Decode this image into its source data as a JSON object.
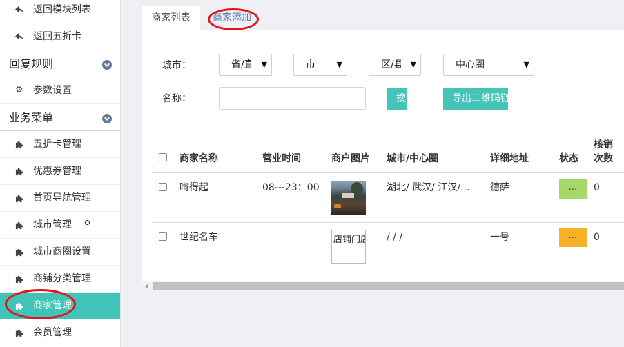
{
  "colors": {
    "accent": "#40c4b7",
    "button": "#45c5b7",
    "annotation": "#e6121b",
    "tab_link": "#5b7fba",
    "chevron": "#647a96"
  },
  "sidebar": {
    "top_links": [
      {
        "label": "返回模块列表",
        "icon": "back-arrow-icon"
      },
      {
        "label": "返回五折卡",
        "icon": "back-arrow-icon"
      }
    ],
    "sections": [
      {
        "title": "回复规则",
        "icon": "chevron-down-circle-icon",
        "items": [
          {
            "label": "参数设置",
            "icon": "gear-icon"
          }
        ]
      },
      {
        "title": "业务菜单",
        "icon": "chevron-down-circle-icon",
        "items": [
          {
            "label": "五折卡管理",
            "icon": "puzzle-icon"
          },
          {
            "label": "优惠券管理",
            "icon": "puzzle-icon"
          },
          {
            "label": "首页导航管理",
            "icon": "puzzle-icon"
          },
          {
            "label": "城市管理",
            "icon": "puzzle-icon"
          },
          {
            "label": "城市商圈设置",
            "icon": "puzzle-icon"
          },
          {
            "label": "商铺分类管理",
            "icon": "puzzle-icon"
          },
          {
            "label": "商家管理",
            "icon": "puzzle-icon",
            "active": true
          },
          {
            "label": "会员管理",
            "icon": "puzzle-icon"
          }
        ]
      }
    ]
  },
  "tabs": [
    {
      "label": "商家列表",
      "active": true
    },
    {
      "label": "商家添加",
      "active": false
    }
  ],
  "filters": {
    "city_label": "城市：",
    "province_select": "省/直",
    "city_select": "市",
    "district_select": "区/县",
    "circle_select": "中心圈",
    "name_label": "名称：",
    "search_button": "搜索",
    "export_button": "导出二维码链接"
  },
  "table": {
    "headers": {
      "name": "商家名称",
      "hours": "营业时间",
      "image": "商户图片",
      "city": "城市/中心圈",
      "address": "详细地址",
      "status": "状态",
      "count_line1": "核销",
      "count_line2": "次数"
    },
    "rows": [
      {
        "name": "啃得起",
        "hours": "08---23：00",
        "city": "湖北/ 武汉/ 江汉/...",
        "address": "德萨",
        "status": "...",
        "status_color": "#a6d96a",
        "count": "0"
      },
      {
        "name": "世纪名车",
        "image_alt": "店铺门店",
        "city": "/ / /",
        "address": "一号",
        "status": "...",
        "status_color": "#f6b127",
        "count": "0"
      }
    ]
  }
}
